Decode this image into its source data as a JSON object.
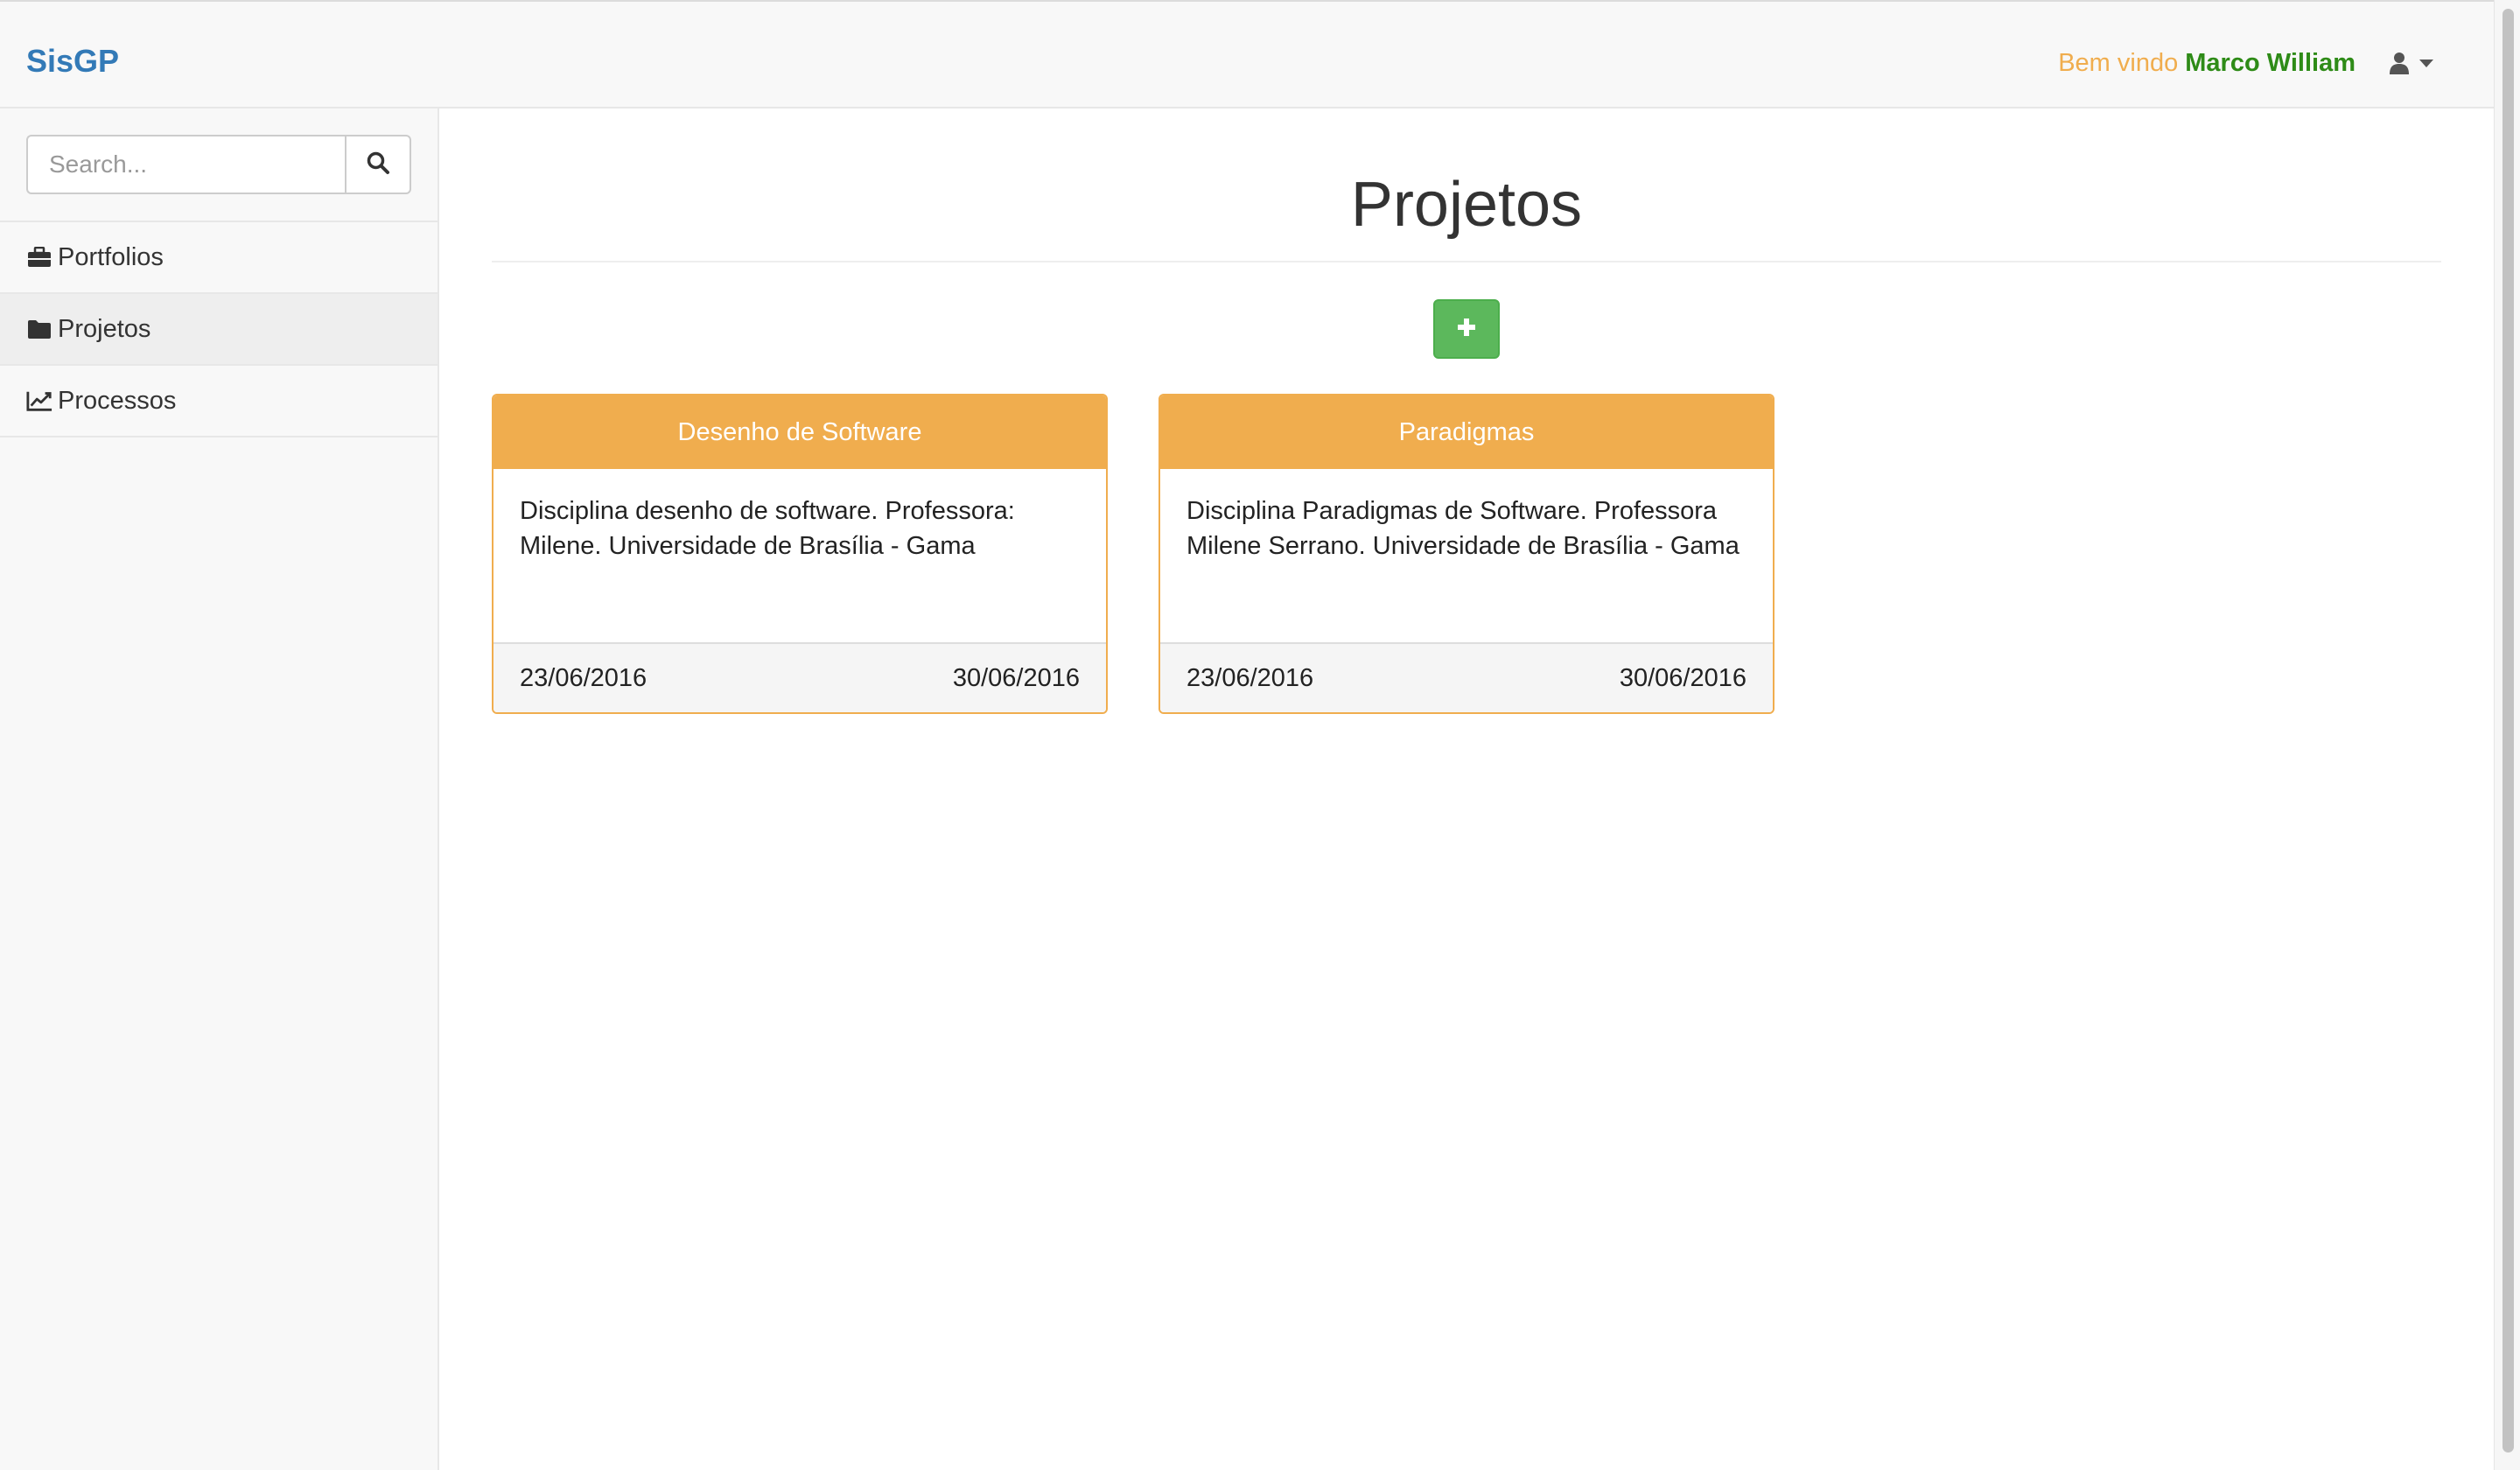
{
  "navbar": {
    "brand": "SisGP",
    "welcome_text": "Bem vindo",
    "user_name": "Marco William",
    "user_icon": "user-icon",
    "caret_icon": "caret-down-icon"
  },
  "sidebar": {
    "search": {
      "placeholder": "Search...",
      "value": "",
      "button_icon": "search-icon"
    },
    "items": [
      {
        "label": "Portfolios",
        "icon": "briefcase-icon",
        "active": false
      },
      {
        "label": "Projetos",
        "icon": "folder-icon",
        "active": true
      },
      {
        "label": "Processos",
        "icon": "line-chart-icon",
        "active": false
      }
    ]
  },
  "main": {
    "title": "Projetos",
    "add_button_icon": "plus-icon",
    "projects": [
      {
        "name": "Desenho de Software",
        "description": "Disciplina desenho de software. Professora: Milene. Universidade de Brasília - Gama",
        "start_date": "23/06/2016",
        "end_date": "30/06/2016"
      },
      {
        "name": "Paradigmas",
        "description": "Disciplina Paradigmas de Software. Professora Milene Serrano. Universidade de Brasília - Gama",
        "start_date": "23/06/2016",
        "end_date": "30/06/2016"
      }
    ]
  },
  "colors": {
    "brand": "#337ab7",
    "welcome": "#f0ad4e",
    "user_name": "#2e8b17",
    "card_accent": "#f0ad4e",
    "add_button": "#5cb85c"
  }
}
